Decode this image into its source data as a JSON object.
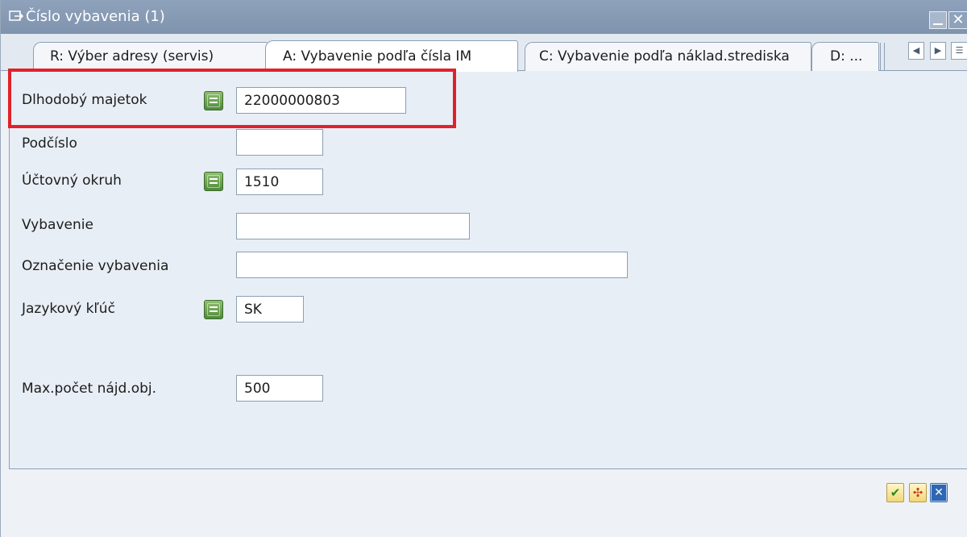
{
  "window": {
    "title": "Číslo vybavenia (1)",
    "close_glyph": "✕"
  },
  "tabs": [
    {
      "label": "R: Výber adresy (servis)",
      "active": false
    },
    {
      "label": "A: Vybavenie podľa čísla IM",
      "active": true
    },
    {
      "label": "C: Vybavenie podľa náklad.strediska",
      "active": false
    },
    {
      "label": "D: ...",
      "active": false
    }
  ],
  "tab_scroll": {
    "left_glyph": "◀",
    "right_glyph": "▶",
    "list_glyph": "☰"
  },
  "fields": {
    "asset": {
      "label": "Dlhodobý majetok",
      "value": "22000000803"
    },
    "subnumber": {
      "label": "Podčíslo",
      "value": ""
    },
    "company_code": {
      "label": "Účtovný okruh",
      "value": "1510"
    },
    "equipment": {
      "label": "Vybavenie",
      "value": ""
    },
    "equipment_desc": {
      "label": "Označenie vybavenia",
      "value": ""
    },
    "language": {
      "label": "Jazykový kľúč",
      "value": "SK"
    },
    "max_hits": {
      "label": "Max.počet nájd.obj.",
      "value": "500"
    }
  },
  "footer": {
    "ok_glyph": "✔",
    "tree_glyph": "✣"
  },
  "colors": {
    "highlight": "#e0212b",
    "titlebar": "#8799b3",
    "match_button": "#5f9a48"
  }
}
